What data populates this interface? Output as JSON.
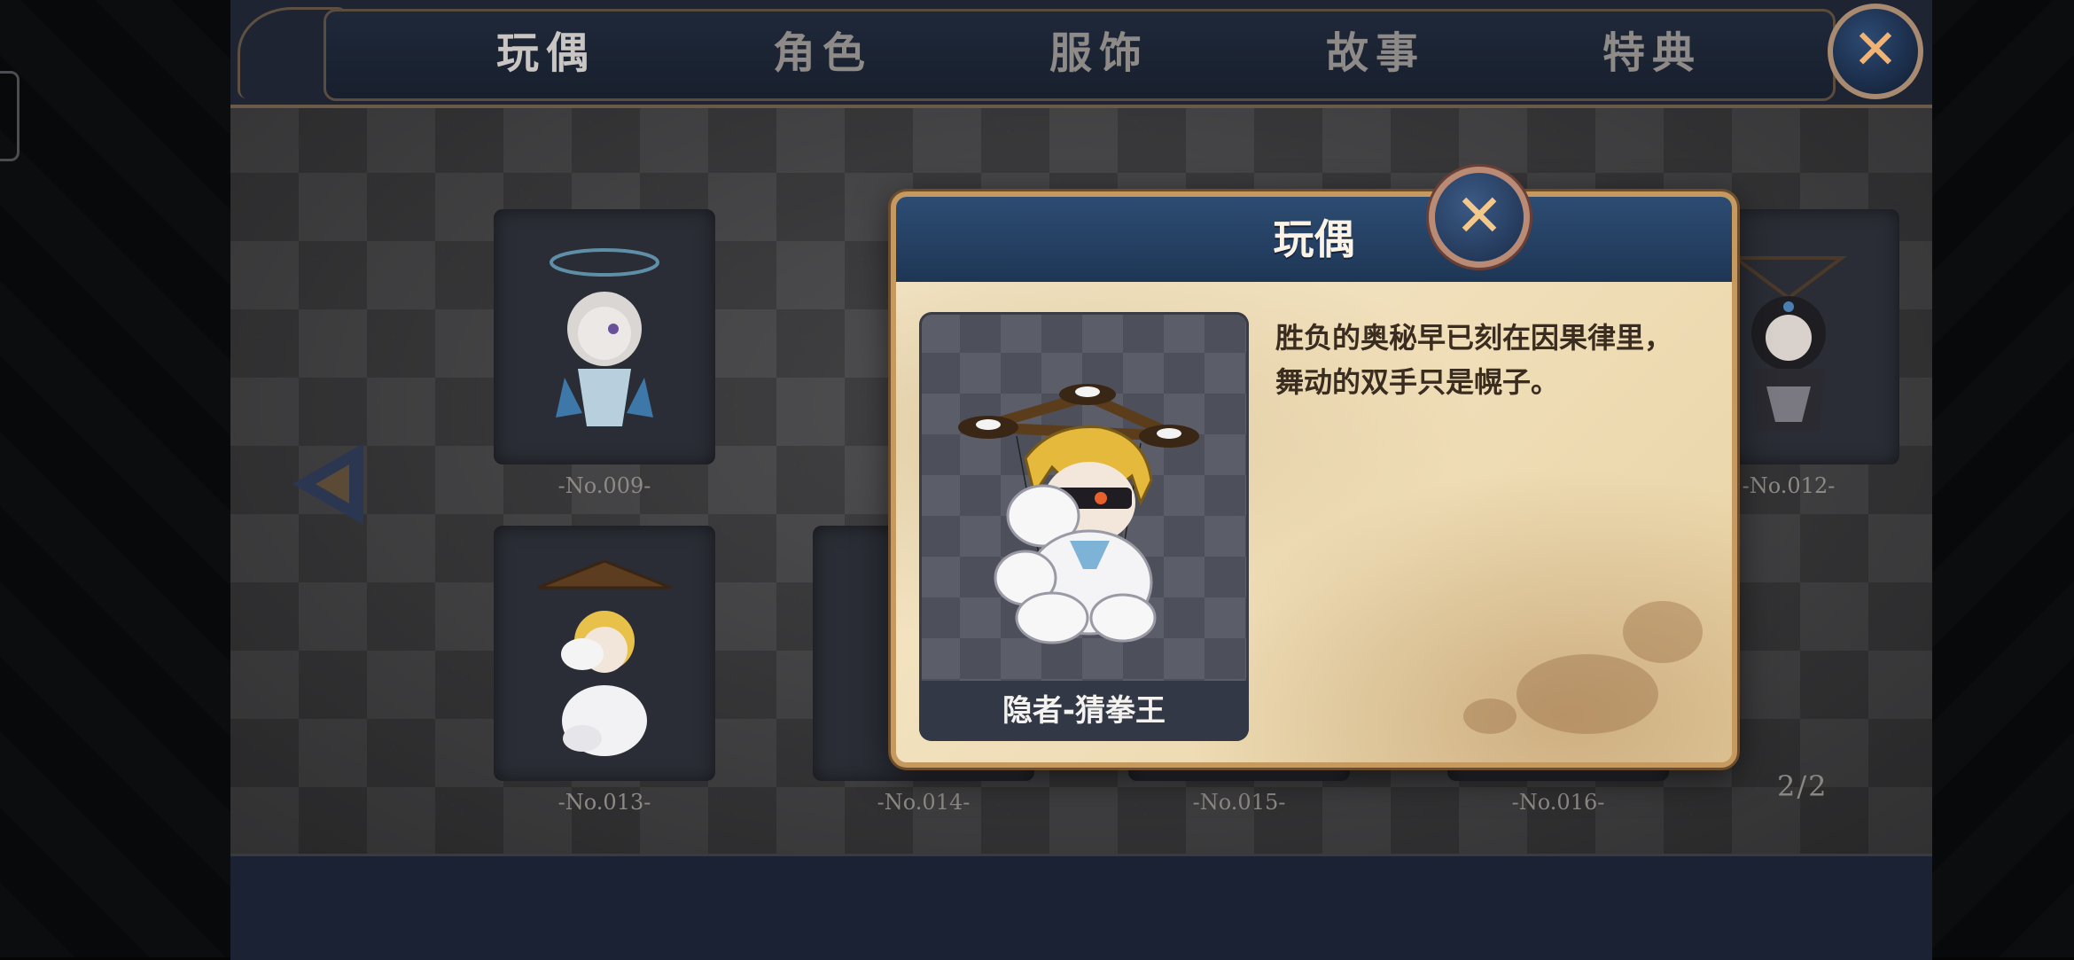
{
  "tabs": [
    {
      "label": "玩偶",
      "active": true
    },
    {
      "label": "角色",
      "active": false
    },
    {
      "label": "服饰",
      "active": false
    },
    {
      "label": "故事",
      "active": false
    },
    {
      "label": "特典",
      "active": false
    }
  ],
  "top_close_icon": "close-icon",
  "grid": {
    "labels": {
      "no009": "-No.009-",
      "no012": "-No.012-",
      "no013": "-No.013-",
      "no014": "-No.014-",
      "no015": "-No.015-",
      "no016": "-No.016-"
    },
    "page_indicator": "2/2",
    "prev_icon": "arrow-left-icon"
  },
  "dialog": {
    "title": "玩偶",
    "close_icon": "close-icon",
    "character_name": "隐者-猜拳王",
    "description_line1": "胜负的奥秘早已刻在因果律里，",
    "description_line2": "舞动的双手只是幌子。"
  },
  "colors": {
    "header_blue": "#2d4c73",
    "gold_border": "#c69a5e",
    "parchment": "#f1e2c0",
    "tab_text": "#8e8a88"
  }
}
